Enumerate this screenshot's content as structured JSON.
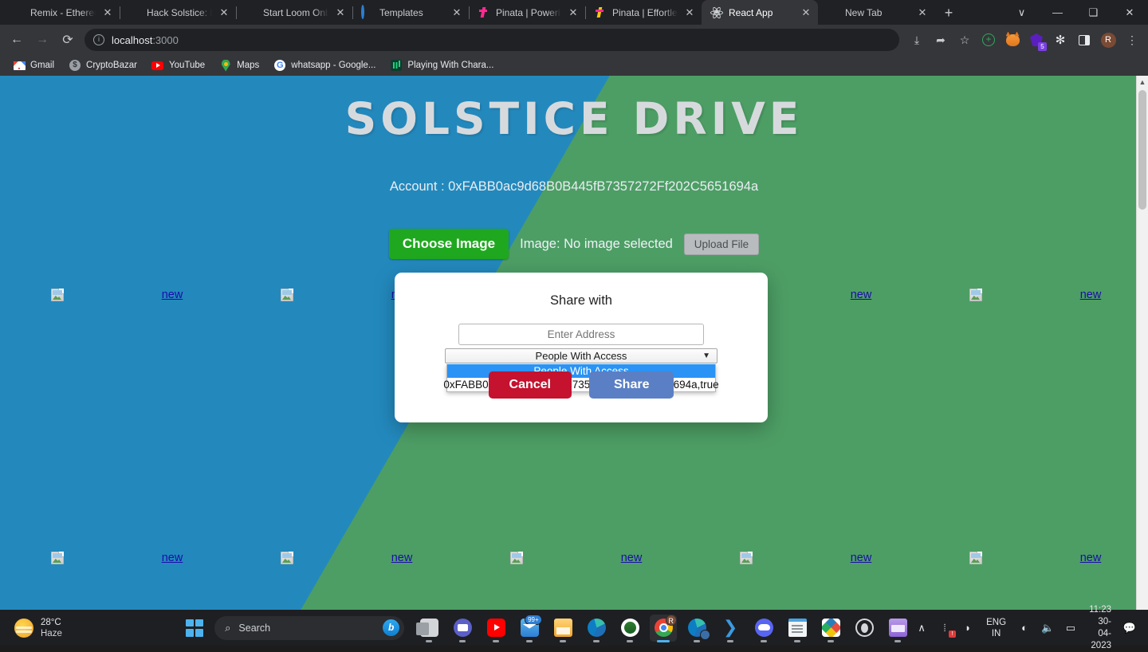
{
  "browser": {
    "tabs": [
      {
        "label": "Remix - Ethereum",
        "favicon": "remix-icon",
        "active": false
      },
      {
        "label": "Hack Solstice: Das",
        "favicon": "notion-icon",
        "active": false
      },
      {
        "label": "Start Loom Onboa",
        "favicon": "loom-icon",
        "active": false
      },
      {
        "label": "Templates",
        "favicon": "ring-icon",
        "active": false
      },
      {
        "label": "Pinata | Powering",
        "favicon": "pinata-icon",
        "active": false
      },
      {
        "label": "Pinata | Effortless",
        "favicon": "pinata-alt-icon",
        "active": false
      },
      {
        "label": "React App",
        "favicon": "react-icon",
        "active": true
      },
      {
        "label": "New Tab",
        "favicon": "chrome-icon",
        "active": false
      }
    ],
    "tab_close_glyph": "✕",
    "new_tab_glyph": "+",
    "window_controls": {
      "list": "∨",
      "minimize": "—",
      "maximize": "❑",
      "close": "✕"
    },
    "nav": {
      "back": "←",
      "forward": "→",
      "reload": "⟳"
    },
    "omnibox": {
      "info_glyph": "ⓘ",
      "host": "localhost",
      "path": ":3000",
      "value": "localhost:3000"
    },
    "toolbar_icons": [
      {
        "name": "install-icon",
        "glyph": "⤓"
      },
      {
        "name": "share-icon",
        "glyph": "➦"
      },
      {
        "name": "bookmark-star-icon",
        "glyph": "☆"
      },
      {
        "name": "add-extension-icon",
        "glyph": "+"
      },
      {
        "name": "metamask-icon",
        "glyph": ""
      },
      {
        "name": "extension-purple-icon",
        "glyph": "",
        "badge": "5"
      },
      {
        "name": "extensions-puzzle-icon",
        "glyph": "🧩"
      },
      {
        "name": "side-panel-icon",
        "glyph": ""
      },
      {
        "name": "profile-avatar",
        "glyph": "R"
      },
      {
        "name": "chrome-menu-icon",
        "glyph": "⋮"
      }
    ],
    "bookmarks": [
      {
        "label": "Gmail",
        "icon": "gmail-icon"
      },
      {
        "label": "CryptoBazar",
        "icon": "cryptobazar-icon"
      },
      {
        "label": "YouTube",
        "icon": "youtube-icon"
      },
      {
        "label": "Maps",
        "icon": "maps-icon"
      },
      {
        "label": "whatsapp - Google...",
        "icon": "google-icon"
      },
      {
        "label": "Playing With Chara...",
        "icon": "play-icon"
      }
    ]
  },
  "page": {
    "title": "SOLSTICE DRIVE",
    "account_label": "Account : 0xFABB0ac9d68B0B445fB7357272Ff202C5651694a",
    "choose_image_label": "Choose Image",
    "image_status": "Image: No image selected",
    "upload_file_label": "Upload File",
    "link_label": "new",
    "grid_rows": [
      [
        "new",
        "new",
        "new",
        "new",
        "new"
      ],
      [
        "new",
        "new",
        "new",
        "new",
        "new"
      ]
    ],
    "colors": {
      "blue": "#2389bd",
      "green": "#4d9e65",
      "title": "#d7dadd",
      "link": "#1a0dab",
      "choose_btn": "#1fa81f"
    }
  },
  "modal": {
    "title": "Share with",
    "address_placeholder": "Enter Address",
    "address_value": "",
    "select_value": "People With Access",
    "select_chevron": "⌄",
    "options": [
      {
        "label": "People With Access",
        "selected": true
      },
      {
        "label": "0xFABB0ac9d68B0B445fB7357272Ff202C5651694a,true",
        "selected": false
      }
    ],
    "cancel_label": "Cancel",
    "share_label": "Share",
    "colors": {
      "cancel": "#c4122f",
      "share": "#5b7fc4",
      "highlight": "#2a93f5"
    }
  },
  "taskbar": {
    "weather": {
      "temp": "28°C",
      "condition": "Haze"
    },
    "search_placeholder": "Search",
    "search_glyph": "⌕",
    "apps": [
      {
        "name": "task-view",
        "icon": "task-view-icon",
        "active": false,
        "running": true
      },
      {
        "name": "teams",
        "icon": "teams-icon",
        "active": false,
        "running": true
      },
      {
        "name": "youtube",
        "icon": "youtube-icon",
        "active": false,
        "running": true
      },
      {
        "name": "mail",
        "icon": "mail-icon",
        "active": false,
        "running": true,
        "badge": "99+"
      },
      {
        "name": "file-explorer",
        "icon": "folder-icon",
        "active": false,
        "running": true
      },
      {
        "name": "edge",
        "icon": "edge-icon",
        "active": false,
        "running": true
      },
      {
        "name": "oval-app",
        "icon": "oval-icon",
        "active": false,
        "running": true
      },
      {
        "name": "chrome",
        "icon": "chrome-icon",
        "active": true,
        "running": true,
        "badge": "R"
      },
      {
        "name": "edge-profile",
        "icon": "edge-profile-icon",
        "active": false,
        "running": true
      },
      {
        "name": "vs-code",
        "icon": "vscode-icon",
        "active": false,
        "running": true
      },
      {
        "name": "discord",
        "icon": "discord-icon",
        "active": false,
        "running": true
      },
      {
        "name": "notepad",
        "icon": "notepad-icon",
        "active": false,
        "running": true
      },
      {
        "name": "paint",
        "icon": "paint-icon",
        "active": false,
        "running": true
      },
      {
        "name": "obs",
        "icon": "obs-icon",
        "active": false,
        "running": false
      },
      {
        "name": "clipchamp",
        "icon": "clipchamp-icon",
        "active": false,
        "running": true
      }
    ],
    "tray": {
      "chevron": "∧",
      "network_glyph": "⦙",
      "mic_glyph": "🎙",
      "language_line1": "ENG",
      "language_line2": "IN",
      "wifi_glyph": "◠",
      "volume_glyph": "🔊",
      "battery_glyph": "▭",
      "time": "11:23",
      "date": "30-04-2023",
      "notification_glyph": "🗨"
    }
  }
}
